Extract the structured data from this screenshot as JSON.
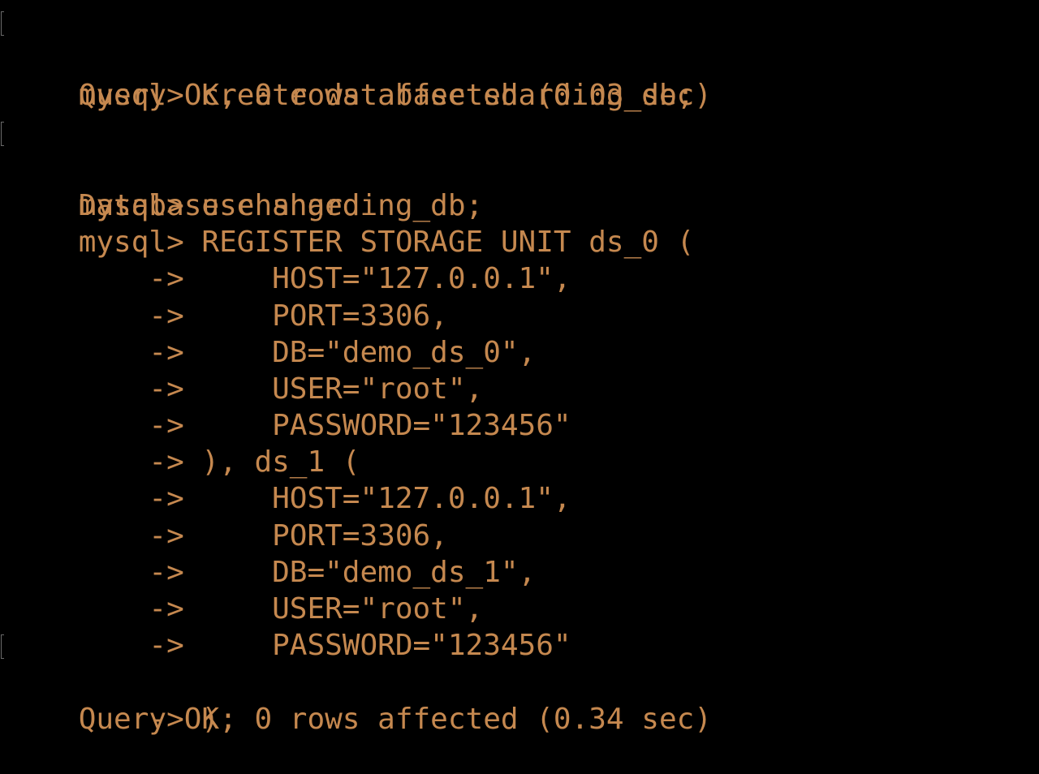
{
  "terminal": {
    "lines": [
      {
        "text": "mysql> create database sharding_db;",
        "marked": true
      },
      {
        "text": "Query OK, 0 rows affected (0.03 sec)",
        "marked": false
      },
      {
        "text": "",
        "marked": false
      },
      {
        "text": "mysql> use sharding_db;",
        "marked": true
      },
      {
        "text": "Database changed",
        "marked": false
      },
      {
        "text": "mysql> REGISTER STORAGE UNIT ds_0 (",
        "marked": false
      },
      {
        "text": "    ->     HOST=\"127.0.0.1\",",
        "marked": false
      },
      {
        "text": "    ->     PORT=3306,",
        "marked": false
      },
      {
        "text": "    ->     DB=\"demo_ds_0\",",
        "marked": false
      },
      {
        "text": "    ->     USER=\"root\",",
        "marked": false
      },
      {
        "text": "    ->     PASSWORD=\"123456\"",
        "marked": false
      },
      {
        "text": "    -> ), ds_1 (",
        "marked": false
      },
      {
        "text": "    ->     HOST=\"127.0.0.1\",",
        "marked": false
      },
      {
        "text": "    ->     PORT=3306,",
        "marked": false
      },
      {
        "text": "    ->     DB=\"demo_ds_1\",",
        "marked": false
      },
      {
        "text": "    ->     USER=\"root\",",
        "marked": false
      },
      {
        "text": "    ->     PASSWORD=\"123456\"",
        "marked": false
      },
      {
        "text": "    -> );",
        "marked": true
      },
      {
        "text": "Query OK, 0 rows affected (0.34 sec)",
        "marked": false
      }
    ]
  },
  "colors": {
    "background": "#000000",
    "text": "#c5884f",
    "mark": "#6b6b6b"
  }
}
